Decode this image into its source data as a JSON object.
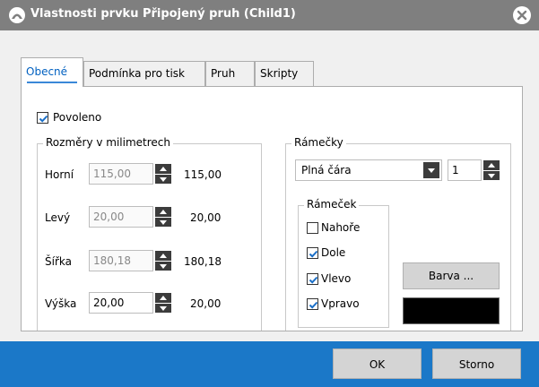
{
  "window": {
    "title": "Vlastnosti prvku Připojený pruh (Child1)"
  },
  "tabs": [
    {
      "label": "Obecné",
      "active": true
    },
    {
      "label": "Podmínka pro tisk",
      "active": false
    },
    {
      "label": "Pruh",
      "active": false
    },
    {
      "label": "Skripty",
      "active": false
    }
  ],
  "general": {
    "enabled_label": "Povoleno",
    "enabled_checked": true
  },
  "dimensions": {
    "group_title": "Rozměry v milimetrech",
    "rows": [
      {
        "label": "Horní",
        "input": "115,00",
        "value": "115,00",
        "disabled": true
      },
      {
        "label": "Levý",
        "input": "20,00",
        "value": "20,00",
        "disabled": true
      },
      {
        "label": "Šířka",
        "input": "180,18",
        "value": "180,18",
        "disabled": true
      },
      {
        "label": "Výška",
        "input": "20,00",
        "value": "20,00",
        "disabled": false
      }
    ]
  },
  "frames": {
    "group_title": "Rámečky",
    "line_style": "Plná čára",
    "line_width": "1",
    "frame_group_title": "Rámeček",
    "sides": [
      {
        "label": "Nahoře",
        "checked": false
      },
      {
        "label": "Dole",
        "checked": true
      },
      {
        "label": "Vlevo",
        "checked": true
      },
      {
        "label": "Vpravo",
        "checked": true
      }
    ],
    "color_button": "Barva ...",
    "color": "#000000"
  },
  "footer": {
    "ok_label": "OK",
    "cancel_label": "Storno"
  },
  "colors": {
    "titlebar": "#7f7f7f",
    "accent": "#1b78c8",
    "check": "#1a6fc8"
  }
}
